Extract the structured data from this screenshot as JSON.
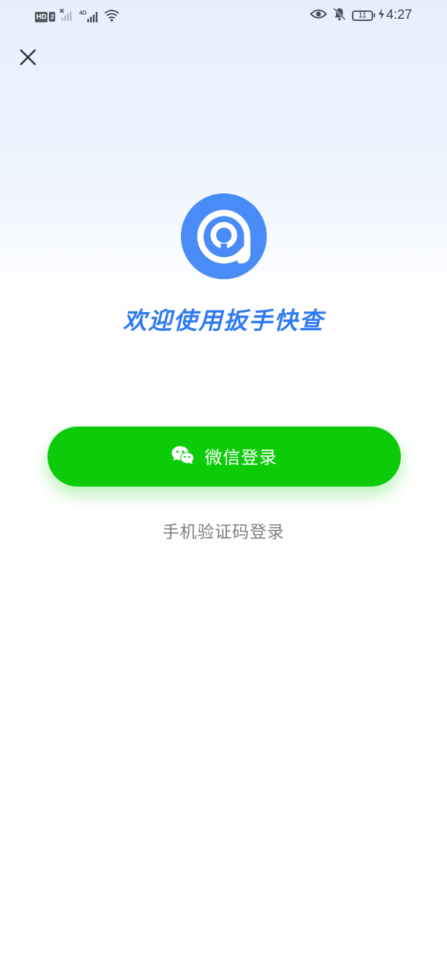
{
  "status_bar": {
    "hd_label": "HD",
    "sim_slot": "2",
    "network_type": "4G",
    "battery_level": "11",
    "time": "4:27",
    "icons": [
      "hd-icon",
      "signal-off-icon",
      "signal-4g-icon",
      "wifi-icon",
      "eye-icon",
      "bell-muted-icon",
      "battery-icon",
      "charging-icon"
    ]
  },
  "header": {
    "close_icon": "close-icon"
  },
  "brand": {
    "logo_icon": "app-logo-icon",
    "logo_color": "#4a8cf7",
    "welcome_text": "欢迎使用扳手快查",
    "welcome_color": "#2f7af2"
  },
  "login": {
    "wechat_label": "微信登录",
    "wechat_icon": "wechat-icon",
    "wechat_color": "#0ccc0a",
    "sms_label": "手机验证码登录",
    "sms_color": "#7f7f7f"
  }
}
